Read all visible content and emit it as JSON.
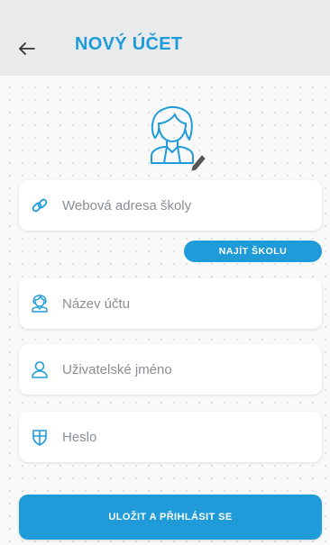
{
  "header": {
    "title": "NOVÝ ÚČET",
    "back_icon": "arrow-left-icon"
  },
  "avatar": {
    "icon": "user-avatar-icon",
    "edit_icon": "pencil-icon"
  },
  "form": {
    "school_url": {
      "placeholder": "Webová adresa školy",
      "icon": "link-icon"
    },
    "find_school_label": "NAJÍT ŠKOLU",
    "account_name": {
      "placeholder": "Název účtu",
      "icon": "user-avatar-icon"
    },
    "username": {
      "placeholder": "Uživatelské jméno",
      "icon": "user-icon"
    },
    "password": {
      "placeholder": "Heslo",
      "icon": "shield-icon"
    }
  },
  "save_label": "ULOŽIT A PŘIHLÁSIT SE",
  "colors": {
    "accent": "#1e9bd8",
    "header_bg": "#e9eaec",
    "placeholder": "#8a8f96"
  }
}
